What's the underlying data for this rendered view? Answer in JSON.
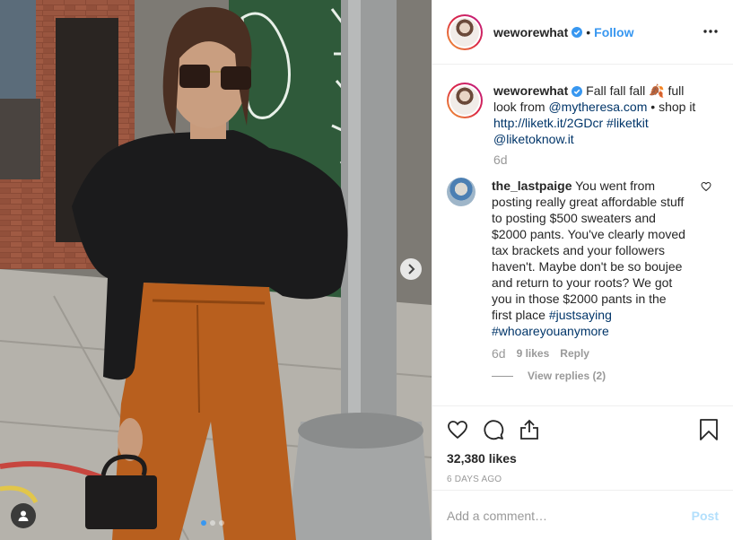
{
  "post": {
    "username": "weworewhat",
    "follow_label": "Follow",
    "separator": "•",
    "caption_parts": {
      "text1": " Fall fall fall 🍂 full look from ",
      "mention1": "@mytheresa.com",
      "text2": " • shop it ",
      "link": "http://liketk.it/2GDcr",
      "space": " ",
      "hashtag": "#liketkit",
      "mention2": "@liketoknow.it"
    },
    "caption_time": "6d",
    "likes": "32,380 likes",
    "posted_ago": "6 DAYS AGO"
  },
  "comment": {
    "username": "the_lastpaige",
    "text": " You went from posting really great affordable stuff to posting $500 sweaters and $2000 pants. You've clearly moved tax brackets and your followers haven't. Maybe don't be so boujee and return to your roots? We got you in those $2000 pants in the first place ",
    "hashtag1": "#justsaying",
    "hashtag2": "#whoareyouanymore",
    "time": "6d",
    "likes": "9 likes",
    "reply_label": "Reply",
    "view_replies": "View replies (2)"
  },
  "add_comment": {
    "placeholder": "Add a comment…",
    "post_label": "Post"
  },
  "carousel": {
    "total": 3,
    "active": 0
  },
  "icons": {
    "more": "more-options-icon",
    "heart": "heart-icon",
    "comment": "comment-icon",
    "share": "share-icon",
    "save": "bookmark-icon",
    "next": "chevron-right-icon",
    "tag": "user-tag-icon",
    "verified": "verified-badge-icon"
  },
  "colors": {
    "accent": "#3897f0",
    "link": "#003569",
    "muted": "#999999",
    "post_disabled": "#b2dffc"
  }
}
